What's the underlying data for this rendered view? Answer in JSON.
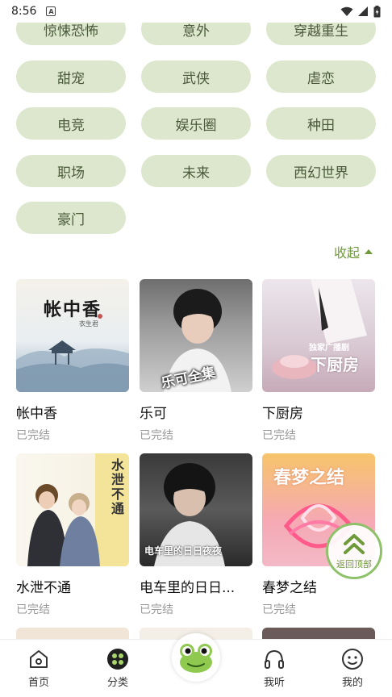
{
  "status_bar": {
    "time": "8:56",
    "notif": "A"
  },
  "genres": [
    "惊悚恐怖",
    "意外",
    "穿越重生",
    "甜宠",
    "武侠",
    "虐恋",
    "电竞",
    "娱乐圈",
    "种田",
    "职场",
    "未来",
    "西幻世界",
    "豪门"
  ],
  "collapse_label": "收起",
  "books": [
    {
      "title": "帐中香",
      "status": "已完结",
      "cover_text": "帐中香",
      "cover_sub": "衣生君"
    },
    {
      "title": "乐可",
      "status": "已完结",
      "cover_text": "乐可全集"
    },
    {
      "title": "下厨房",
      "status": "已完结",
      "cover_text": "下厨房",
      "cover_sub": "独家广播剧"
    },
    {
      "title": "水泄不通",
      "status": "已完结",
      "cover_text": "水泄不通"
    },
    {
      "title": "电车里的日日...",
      "status": "已完结",
      "cover_text": "电车里的日日夜夜"
    },
    {
      "title": "春梦之结",
      "status": "已完结",
      "cover_text": "春梦之结"
    }
  ],
  "back_to_top": "返回顶部",
  "tabs": [
    {
      "label": "首页",
      "icon": "home-icon"
    },
    {
      "label": "分类",
      "icon": "category-icon"
    },
    {
      "label": "",
      "icon": "frog-icon"
    },
    {
      "label": "我听",
      "icon": "headphones-icon"
    },
    {
      "label": "我的",
      "icon": "profile-icon"
    }
  ],
  "colors": {
    "chip_bg": "#dde7cd",
    "accent": "#6f9a3a"
  }
}
